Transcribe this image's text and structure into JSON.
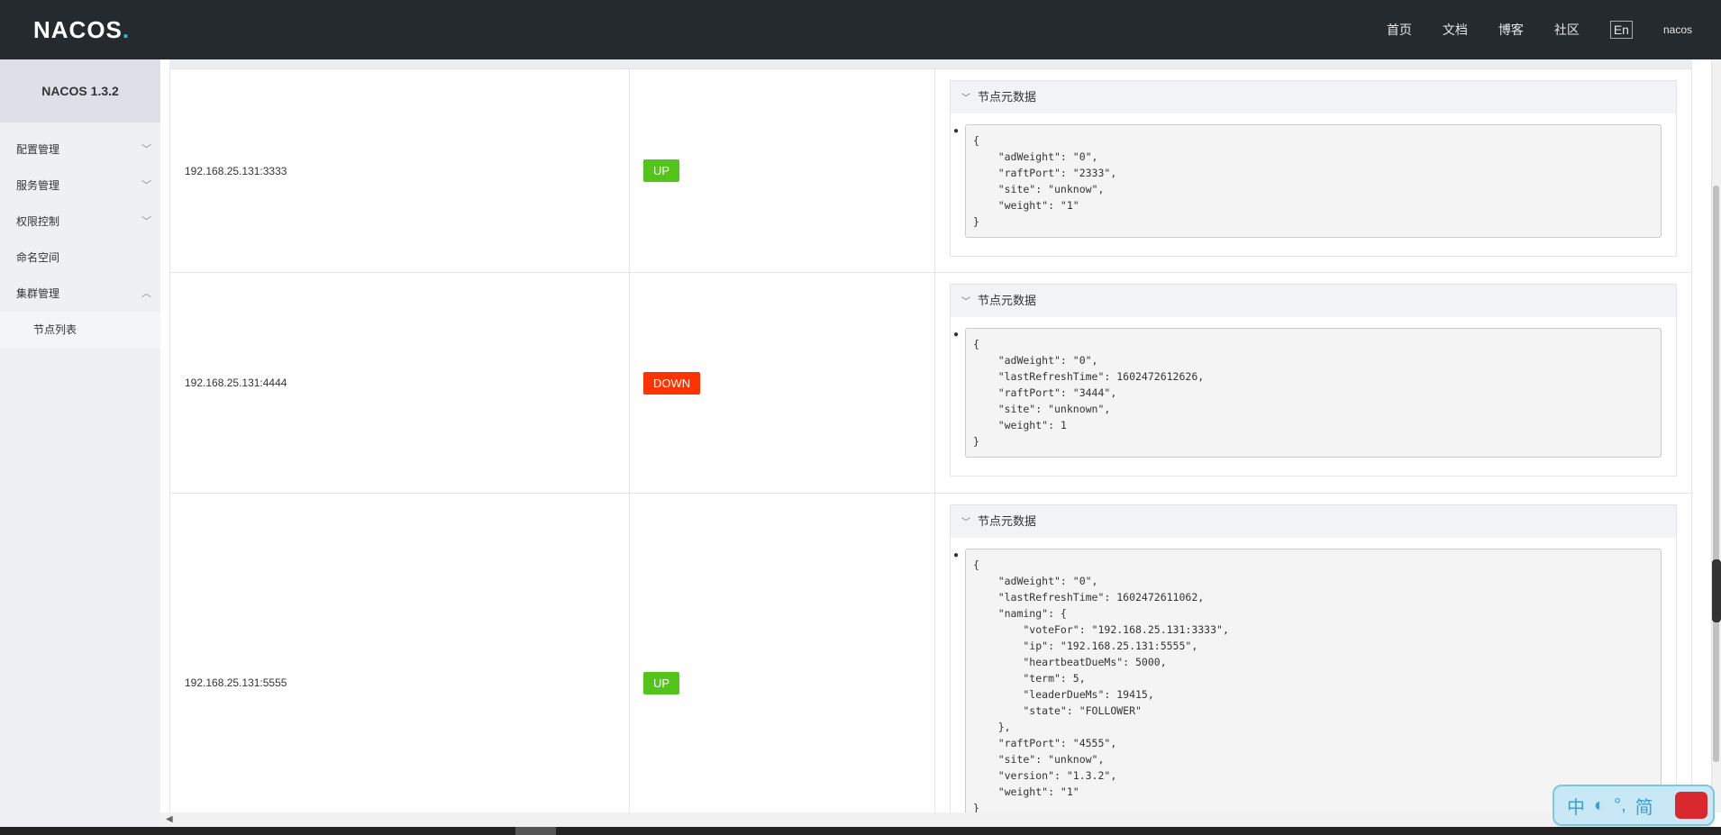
{
  "header": {
    "logo": "NACOS",
    "logo_dot": ".",
    "nav": [
      "首页",
      "文档",
      "博客",
      "社区"
    ],
    "lang": "En",
    "user": "nacos"
  },
  "sidebar": {
    "title": "NACOS 1.3.2",
    "items": [
      {
        "label": "配置管理"
      },
      {
        "label": "服务管理"
      },
      {
        "label": "权限控制"
      },
      {
        "label": "命名空间"
      },
      {
        "label": "集群管理"
      }
    ],
    "subitems": [
      {
        "label": "节点列表"
      }
    ]
  },
  "nodes": [
    {
      "ip": "192.168.25.131:3333",
      "state": "UP",
      "meta_title": "节点元数据",
      "metadata": "{\n    \"adWeight\": \"0\",\n    \"raftPort\": \"2333\",\n    \"site\": \"unknow\",\n    \"weight\": \"1\"\n}"
    },
    {
      "ip": "192.168.25.131:4444",
      "state": "DOWN",
      "meta_title": "节点元数据",
      "metadata": "{\n    \"adWeight\": \"0\",\n    \"lastRefreshTime\": 1602472612626,\n    \"raftPort\": \"3444\",\n    \"site\": \"unknown\",\n    \"weight\": 1\n}"
    },
    {
      "ip": "192.168.25.131:5555",
      "state": "UP",
      "meta_title": "节点元数据",
      "metadata": "{\n    \"adWeight\": \"0\",\n    \"lastRefreshTime\": 1602472611062,\n    \"naming\": {\n        \"voteFor\": \"192.168.25.131:3333\",\n        \"ip\": \"192.168.25.131:5555\",\n        \"heartbeatDueMs\": 5000,\n        \"term\": 5,\n        \"leaderDueMs\": 19415,\n        \"state\": \"FOLLOWER\"\n    },\n    \"raftPort\": \"4555\",\n    \"site\": \"unknow\",\n    \"version\": \"1.3.2\",\n    \"weight\": \"1\"\n}"
    }
  ],
  "ime": {
    "items": [
      "中",
      "◐",
      "°,",
      "简"
    ]
  },
  "colors": {
    "header_bg": "#252a2f",
    "up": "#52c41a",
    "down": "#ff3300",
    "logo_accent": "#35b6e8"
  }
}
